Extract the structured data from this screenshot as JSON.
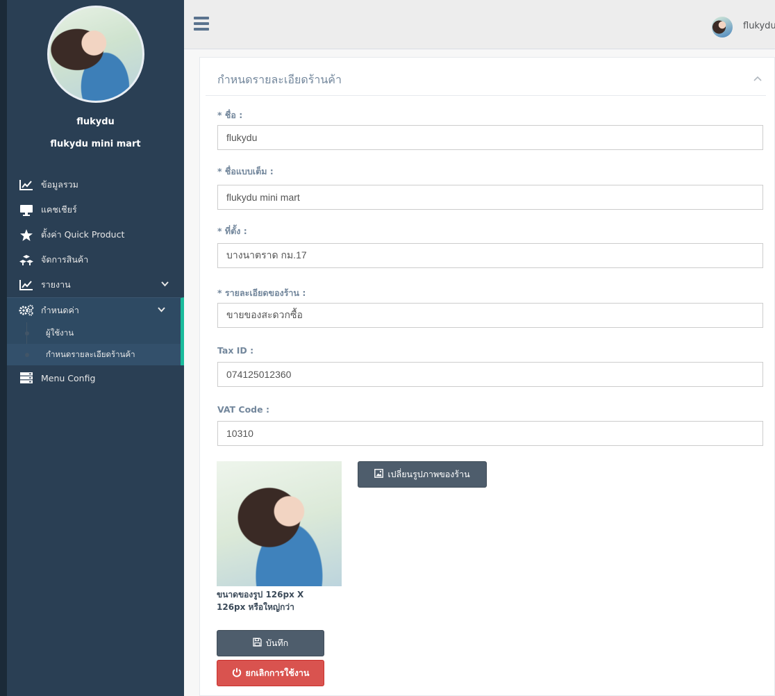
{
  "colors": {
    "sidebar_bg": "#2a3f54",
    "active_accent": "#1abb9c",
    "primary_button": "#4e5d6c",
    "danger_button": "#d9534f"
  },
  "sidebar": {
    "profile_name": "flukydu",
    "shop_name": "flukydu mini mart",
    "items": [
      {
        "label": "ข้อมูลรวม",
        "icon": "line-chart-icon"
      },
      {
        "label": "แคชเชียร์",
        "icon": "monitor-icon"
      },
      {
        "label": "ตั้งค่า Quick Product",
        "icon": "star-icon"
      },
      {
        "label": "จัดการสินค้า",
        "icon": "cubes-icon"
      },
      {
        "label": "รายงาน",
        "icon": "line-chart-icon",
        "has_submenu": true
      },
      {
        "label": "กำหนดค่า",
        "icon": "gears-icon",
        "has_submenu": true,
        "expanded": true
      },
      {
        "label": "Menu Config",
        "icon": "server-icon"
      }
    ],
    "settings_submenu": [
      {
        "label": "ผู้ใช้งาน"
      },
      {
        "label": "กำหนดรายละเอียดร้านค้า"
      }
    ]
  },
  "topnav": {
    "username": "flukydu"
  },
  "panel": {
    "title": "กำหนดรายละเอียดร้านค้า"
  },
  "form": {
    "name_label": "* ชื่อ :",
    "name_value": "flukydu",
    "fullname_label": "* ชื่อแบบเต็ม :",
    "fullname_value": "flukydu mini mart",
    "location_label": "* ที่ตั้ง :",
    "location_value": "บางนาตราด กม.17",
    "details_label": "* รายละเอียดของร้าน :",
    "details_value": "ขายของสะดวกซื้อ",
    "taxid_label": "Tax ID :",
    "taxid_value": "074125012360",
    "vat_label": "VAT Code :",
    "vat_value": "10310",
    "change_image_label": "เปลี่ยนรูปภาพของร้าน",
    "image_note": "ขนาดของรูป 126px X 126px หรือใหญ่กว่า",
    "save_label": "บันทึก",
    "cancel_label": "ยกเลิกการใช้งาน"
  }
}
